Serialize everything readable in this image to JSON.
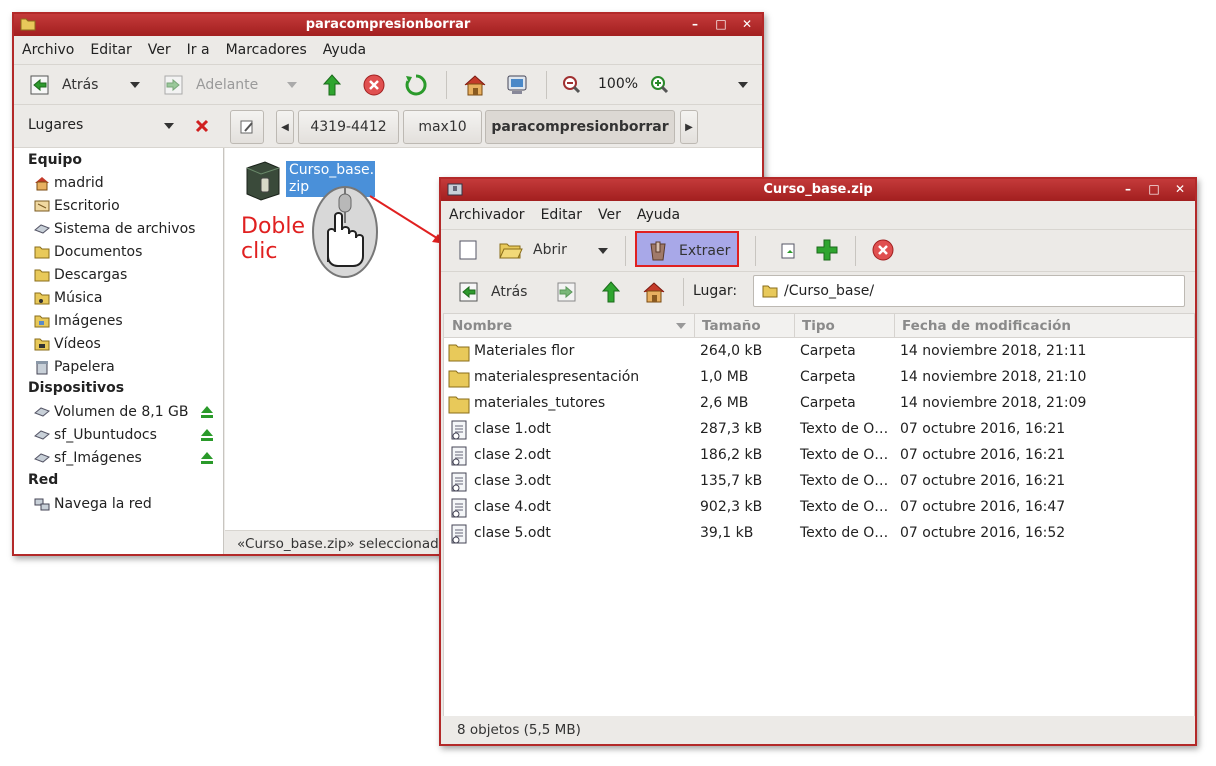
{
  "nautilus": {
    "title": "paracompresionborrar",
    "menu": [
      "Archivo",
      "Editar",
      "Ver",
      "Ir a",
      "Marcadores",
      "Ayuda"
    ],
    "toolbar": {
      "back": "Atrás",
      "forward": "Adelante",
      "zoom": "100%"
    },
    "places_label": "Lugares",
    "crumbs": [
      "4319-4412",
      "max10",
      "paracompresionborrar"
    ],
    "sidebar": {
      "sections": [
        {
          "heading": "Equipo",
          "items": [
            {
              "label": "madrid",
              "icon": "home-icon"
            },
            {
              "label": "Escritorio",
              "icon": "desktop-icon"
            },
            {
              "label": "Sistema de archivos",
              "icon": "drive-icon"
            },
            {
              "label": "Documentos",
              "icon": "folder-icon"
            },
            {
              "label": "Descargas",
              "icon": "folder-icon"
            },
            {
              "label": "Música",
              "icon": "music-folder-icon"
            },
            {
              "label": "Imágenes",
              "icon": "pictures-folder-icon"
            },
            {
              "label": "Vídeos",
              "icon": "videos-folder-icon"
            },
            {
              "label": "Papelera",
              "icon": "trash-icon"
            }
          ]
        },
        {
          "heading": "Dispositivos",
          "items": [
            {
              "label": "Volumen de 8,1 GB",
              "icon": "drive-icon",
              "eject": true
            },
            {
              "label": "sf_Ubuntudocs",
              "icon": "drive-icon",
              "eject": true
            },
            {
              "label": "sf_Imágenes",
              "icon": "drive-icon",
              "eject": true
            }
          ]
        },
        {
          "heading": "Red",
          "items": [
            {
              "label": "Navega la red",
              "icon": "network-icon"
            }
          ]
        }
      ]
    },
    "file_name_line1": "Curso_base.",
    "file_name_line2": "zip",
    "status": "«Curso_base.zip» seleccionado"
  },
  "annotation": {
    "line1": "Doble",
    "line2": "clic",
    "color": "#e02020"
  },
  "archive": {
    "title": "Curso_base.zip",
    "menu": [
      "Archivador",
      "Editar",
      "Ver",
      "Ayuda"
    ],
    "toolbar": {
      "open": "Abrir",
      "extract": "Extraer",
      "back": "Atrás",
      "location_label": "Lugar:",
      "location_value": "/Curso_base/"
    },
    "columns": [
      "Nombre",
      "Tamaño",
      "Tipo",
      "Fecha de modificación"
    ],
    "rows": [
      {
        "name": "Materiales flor",
        "size": "264,0 kB",
        "type": "Carpeta",
        "date": "14 noviembre 2018, 21:11",
        "kind": "folder"
      },
      {
        "name": "materialespresentación",
        "size": "1,0 MB",
        "type": "Carpeta",
        "date": "14 noviembre 2018, 21:10",
        "kind": "folder"
      },
      {
        "name": "materiales_tutores",
        "size": "2,6 MB",
        "type": "Carpeta",
        "date": "14 noviembre 2018, 21:09",
        "kind": "folder"
      },
      {
        "name": "clase 1.odt",
        "size": "287,3 kB",
        "type": "Texto de O…",
        "date": "07 octubre 2016, 16:21",
        "kind": "doc"
      },
      {
        "name": "clase 2.odt",
        "size": "186,2 kB",
        "type": "Texto de O…",
        "date": "07 octubre 2016, 16:21",
        "kind": "doc"
      },
      {
        "name": "clase 3.odt",
        "size": "135,7 kB",
        "type": "Texto de O…",
        "date": "07 octubre 2016, 16:21",
        "kind": "doc"
      },
      {
        "name": "clase 4.odt",
        "size": "902,3 kB",
        "type": "Texto de O…",
        "date": "07 octubre 2016, 16:47",
        "kind": "doc"
      },
      {
        "name": "clase 5.odt",
        "size": "39,1 kB",
        "type": "Texto de O…",
        "date": "07 octubre 2016, 16:52",
        "kind": "doc"
      }
    ],
    "status": "8 objetos (5,5 MB)"
  }
}
